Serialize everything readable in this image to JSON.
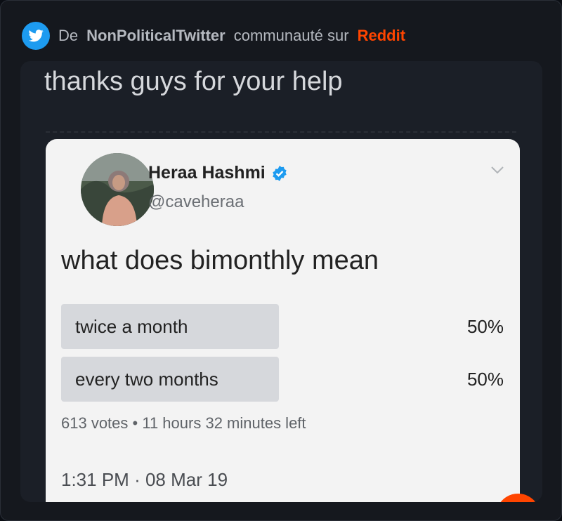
{
  "header": {
    "prefix": "De",
    "community": "NonPoliticalTwitter",
    "middle": "communauté sur",
    "platform": "Reddit",
    "icon": "twitter-bird-icon"
  },
  "post": {
    "caption": "thanks guys for your help"
  },
  "tweet": {
    "author_name": "Heraa Hashmi",
    "handle": "@caveheraa",
    "verified_icon": "verified-badge-icon",
    "question": "what does bimonthly mean",
    "poll": [
      {
        "label": "twice a month",
        "percent_text": "50%",
        "share": 0.5
      },
      {
        "label": "every two months",
        "percent_text": "50%",
        "share": 0.5
      }
    ],
    "votes": "613 votes",
    "separator": "•",
    "time_left": "11 hours 32 minutes left",
    "time": "1:31 PM",
    "time_separator": "·",
    "date": "08 Mar 19"
  },
  "colors": {
    "background": "#15181e",
    "reddit": "#ff4500",
    "twitter_blue": "#1d9bf0",
    "poll_bar": "#d6d8dc"
  }
}
